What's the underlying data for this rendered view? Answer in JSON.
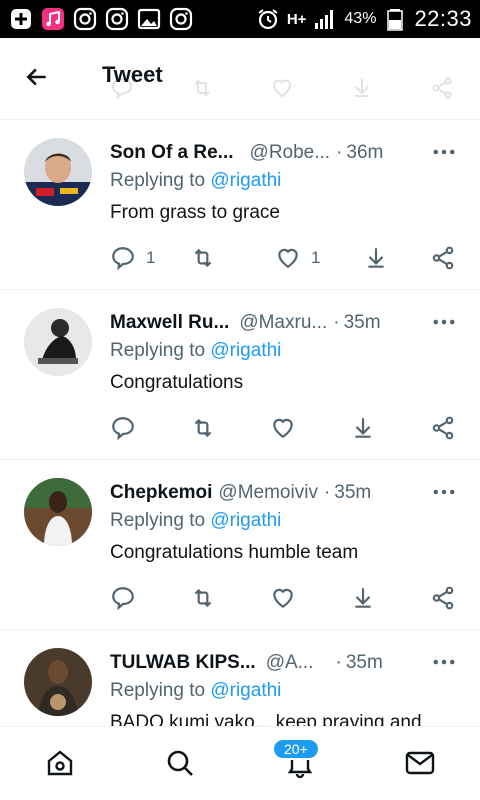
{
  "status_bar": {
    "network": "H+",
    "battery": "43%",
    "time": "22:33",
    "icons": [
      "add-icon",
      "music-app-icon",
      "instagram-icon",
      "instagram-icon",
      "gallery-icon",
      "instagram-icon",
      "alarm-icon",
      "signal-icon",
      "battery-icon"
    ]
  },
  "header": {
    "title": "Tweet"
  },
  "tweets": [
    {
      "name": "Son Of a Re...",
      "handle": "@Robe...",
      "dot": "·",
      "time": "36m",
      "reply_prefix": "Replying to",
      "reply_to": "@rigathi",
      "text": "From grass to grace",
      "reply_count": "1",
      "like_count": "1"
    },
    {
      "name": "Maxwell Ru...",
      "handle": "@Maxru...",
      "dot": "·",
      "time": "35m",
      "reply_prefix": "Replying to",
      "reply_to": "@rigathi",
      "text": "Congratulations",
      "reply_count": "",
      "like_count": ""
    },
    {
      "name": "Chepkemoi",
      "handle": "@Memoiviv",
      "dot": "·",
      "time": "35m",
      "reply_prefix": "Replying to",
      "reply_to": "@rigathi",
      "text": "Congratulations humble team",
      "reply_count": "",
      "like_count": ""
    },
    {
      "name": "TULWAB KIPS...",
      "handle": "@A...",
      "dot": "·",
      "time": "35m",
      "reply_prefix": "Replying to",
      "reply_to": "@rigathi",
      "text": "BADO kumi yako... keep praying and",
      "reply_count": "",
      "like_count": ""
    }
  ],
  "bottom_nav": {
    "notifications_badge": "20+"
  },
  "colors": {
    "accent": "#1d9bf0",
    "text": "#0f1419",
    "muted": "#536471"
  }
}
